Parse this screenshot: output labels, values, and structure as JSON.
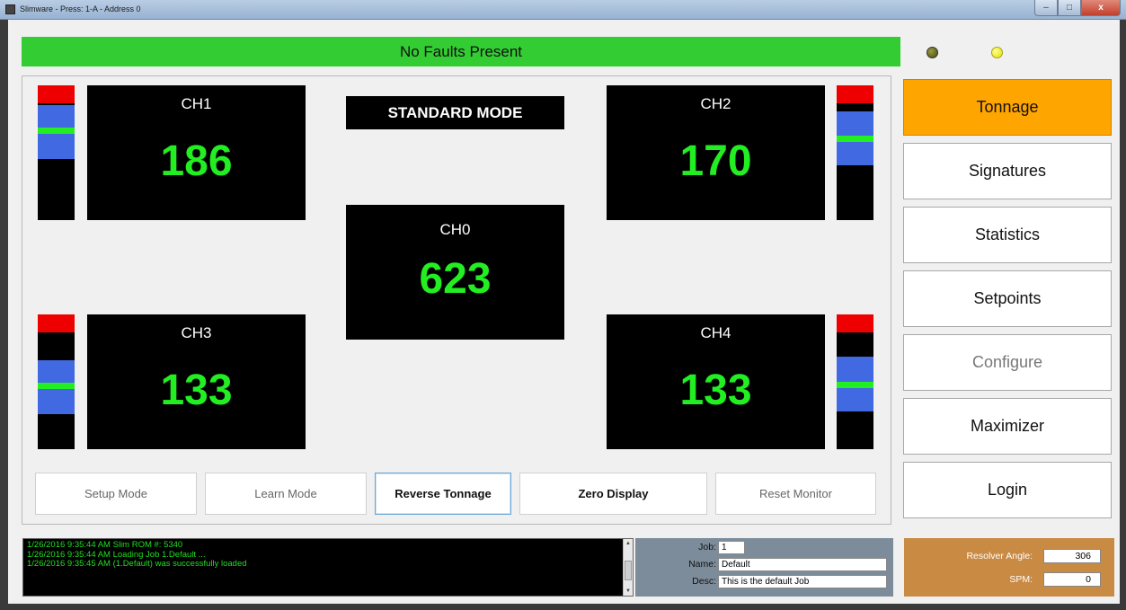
{
  "window": {
    "title": "Slimware - Press: 1-A - Address 0",
    "minimize": "–",
    "maximize": "□",
    "close": "x"
  },
  "status": {
    "fault_text": "No Faults Present",
    "led1_color": "#5a5a18",
    "led2_color": "#f2f200",
    "fault_color": "#33cc33"
  },
  "mode": "STANDARD MODE",
  "channels": {
    "ch0": {
      "label": "CH0",
      "value": "623"
    },
    "ch1": {
      "label": "CH1",
      "value": "186"
    },
    "ch2": {
      "label": "CH2",
      "value": "170"
    },
    "ch3": {
      "label": "CH3",
      "value": "133"
    },
    "ch4": {
      "label": "CH4",
      "value": "133"
    }
  },
  "actions": {
    "setup_mode": "Setup Mode",
    "learn_mode": "Learn Mode",
    "reverse_tonnage": "Reverse Tonnage",
    "zero_display": "Zero Display",
    "reset_monitor": "Reset Monitor"
  },
  "nav": {
    "tonnage": "Tonnage",
    "signatures": "Signatures",
    "statistics": "Statistics",
    "setpoints": "Setpoints",
    "configure": "Configure",
    "maximizer": "Maximizer",
    "login": "Login",
    "active_color": "#ffa500"
  },
  "log": {
    "lines": [
      "1/26/2016 9:35:44 AM  Slim ROM #: 5340",
      "1/26/2016 9:35:44 AM  Loading Job 1.Default ...",
      "1/26/2016 9:35:45 AM  (1.Default) was successfully loaded"
    ]
  },
  "job": {
    "job_label": "Job:",
    "job_value": "1",
    "name_label": "Name:",
    "name_value": "Default",
    "desc_label": "Desc:",
    "desc_value": "This is the default Job"
  },
  "resolver": {
    "angle_label": "Resolver Angle:",
    "angle_value": "306",
    "spm_label": "SPM:",
    "spm_value": "0"
  }
}
